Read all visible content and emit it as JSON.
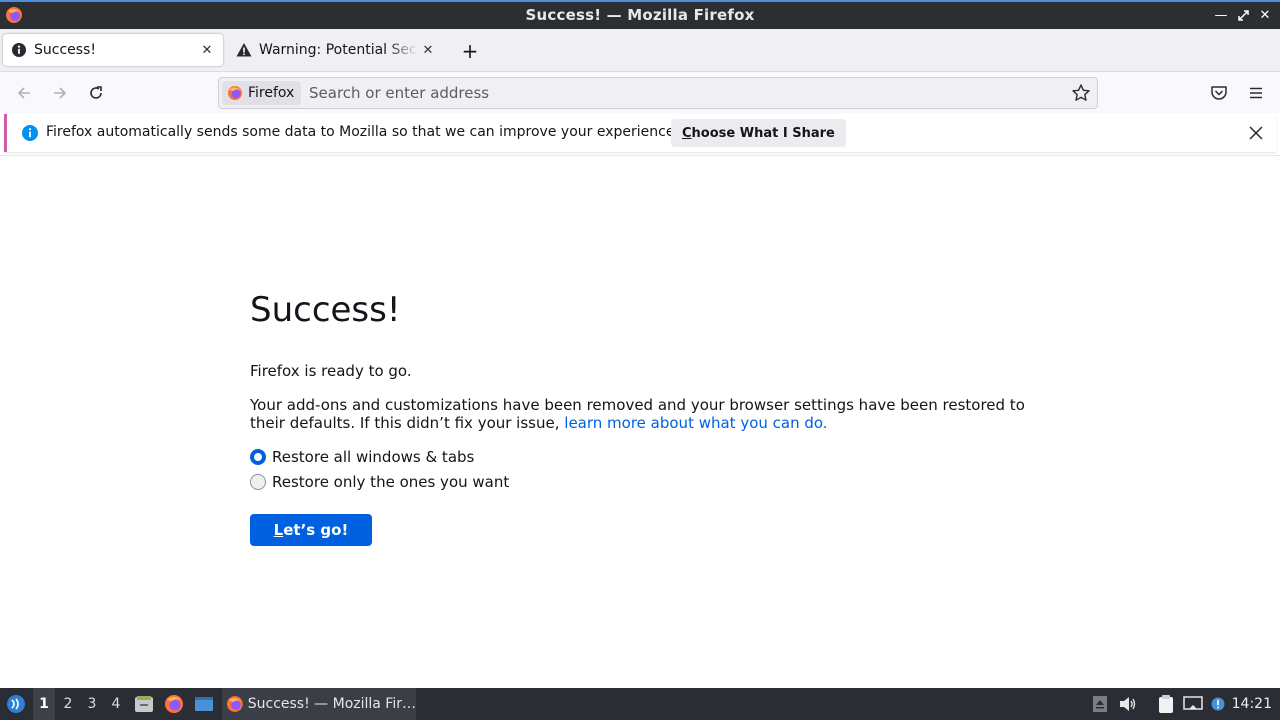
{
  "window": {
    "title": "Success! — Mozilla Firefox"
  },
  "tabs": [
    {
      "label": "Success!",
      "active": true,
      "icon": "info-icon"
    },
    {
      "label": "Warning: Potential Security Risk Ahead",
      "active": false,
      "icon": "warning-icon"
    }
  ],
  "urlbar": {
    "identity_label": "Firefox",
    "placeholder": "Search or enter address",
    "value": ""
  },
  "notification": {
    "message": "Firefox automatically sends some data to Mozilla so that we can improve your experience.",
    "button_mnemonic": "C",
    "button_rest": "hoose What I Share"
  },
  "page": {
    "heading": "Success!",
    "ready_text": "Firefox is ready to go.",
    "body_text": "Your add-ons and customizations have been removed and your browser settings have been restored to their defaults. If this didn’t fix your issue,",
    "link_text": "learn more about what you can do.",
    "radio_all": "Restore all windows & tabs",
    "radio_some": "Restore only the ones you want",
    "selected_option": "all",
    "go_button_mnemonic": "L",
    "go_button_rest": "et’s go!"
  },
  "taskbar": {
    "workspaces": [
      "1",
      "2",
      "3",
      "4"
    ],
    "active_workspace": "1",
    "task_label": "Success! — Mozilla Fir…",
    "clock": "14:21"
  },
  "colors": {
    "accent": "#0061e0",
    "notice_border": "#d15fa8",
    "taskbar_bg": "#2a2d33"
  }
}
